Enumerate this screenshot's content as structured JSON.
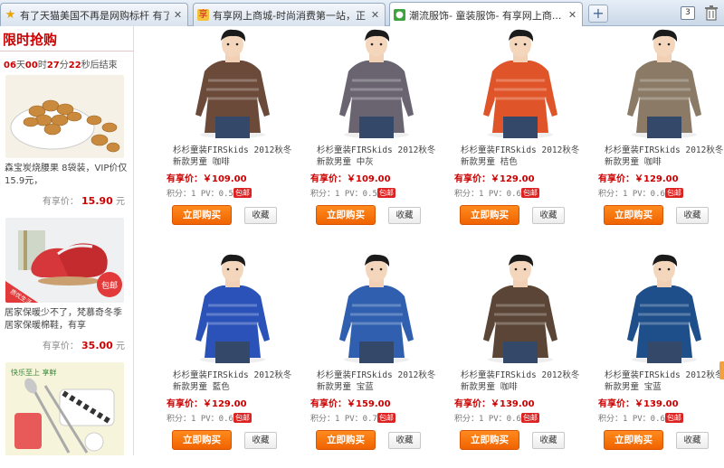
{
  "tabs": [
    {
      "title": "有了天猫美国不再是网购标杆 有了...",
      "icon": "star-icon"
    },
    {
      "title": "有享网上商城-时尚消费第一站，正...",
      "icon": "site-icon"
    },
    {
      "title": "潮流服饰- 童装服饰- 有享网上商...",
      "icon": "site-icon",
      "active": true
    }
  ],
  "toolbar": {
    "new_tab": "+",
    "tab_count": "3"
  },
  "sidebar": {
    "title": "限时抢购",
    "countdown": {
      "days": "06",
      "d": "天",
      "hours": "00",
      "h": "时",
      "minutes": "27",
      "m": "分",
      "seconds": "22",
      "s": "秒后结束"
    },
    "items": [
      {
        "desc": "森宝炭烧腰果 8袋装，VIP价仅15.9元，",
        "price_label": "有享价：",
        "price": "15.90",
        "unit": "元"
      },
      {
        "desc": "居家保暖少不了，梵慕奇冬季居家保暖棉鞋，有享",
        "price_label": "有享价：",
        "price": "35.00",
        "unit": "元",
        "badge": "包邮",
        "tag": "质优生活"
      },
      {
        "desc": "",
        "price_label": "",
        "price": "",
        "unit": "",
        "tag": "快乐至上 享鲜"
      }
    ]
  },
  "products": [
    {
      "name": "杉杉童装FIRSkids 2012秋冬新款男童   咖啡",
      "price_label": "有享价：",
      "price": "￥109.00",
      "points": "积分：1 PV：0.5",
      "badge": "包邮",
      "buy": "立即购买",
      "fav": "收藏",
      "color": "#6b4a3a"
    },
    {
      "name": "杉杉童装FIRSkids 2012秋冬新款男童   中灰",
      "price_label": "有享价：",
      "price": "￥109.00",
      "points": "积分：1 PV：0.5",
      "badge": "包邮",
      "buy": "立即购买",
      "fav": "收藏",
      "color": "#6a6470"
    },
    {
      "name": "杉杉童装FIRSkids 2012秋冬新款男童   桔色",
      "price_label": "有享价：",
      "price": "￥129.00",
      "points": "积分：1 PV：0.6",
      "badge": "包邮",
      "buy": "立即购买",
      "fav": "收藏",
      "color": "#e0542a"
    },
    {
      "name": "杉杉童装FIRSkids 2012秋冬新款男童   咖啡",
      "price_label": "有享价：",
      "price": "￥129.00",
      "points": "积分：1 PV：0.6",
      "badge": "包邮",
      "buy": "立即购买",
      "fav": "收藏",
      "color": "#8a7a66"
    },
    {
      "name": "杉杉童装FIRSkids 2012秋冬新款男童   藍色",
      "price_label": "有享价：",
      "price": "￥129.00",
      "points": "积分：1 PV：0.6",
      "badge": "包邮",
      "buy": "立即购买",
      "fav": "收藏",
      "color": "#2a52b8"
    },
    {
      "name": "杉杉童装FIRSkids 2012秋冬新款男童   宝蓝",
      "price_label": "有享价：",
      "price": "￥159.00",
      "points": "积分：1 PV：0.7",
      "badge": "包邮",
      "buy": "立即购买",
      "fav": "收藏",
      "color": "#2f5fae"
    },
    {
      "name": "杉杉童装FIRSkids 2012秋冬新款男童   咖啡",
      "price_label": "有享价：",
      "price": "￥139.00",
      "points": "积分：1 PV：0.6",
      "badge": "包邮",
      "buy": "立即购买",
      "fav": "收藏",
      "color": "#5a4536"
    },
    {
      "name": "杉杉童装FIRSkids 2012秋冬新款男童   宝蓝",
      "price_label": "有享价：",
      "price": "￥139.00",
      "points": "积分：1 PV：0.6",
      "badge": "包邮",
      "buy": "立即购买",
      "fav": "收藏",
      "color": "#1f4f8a"
    }
  ]
}
